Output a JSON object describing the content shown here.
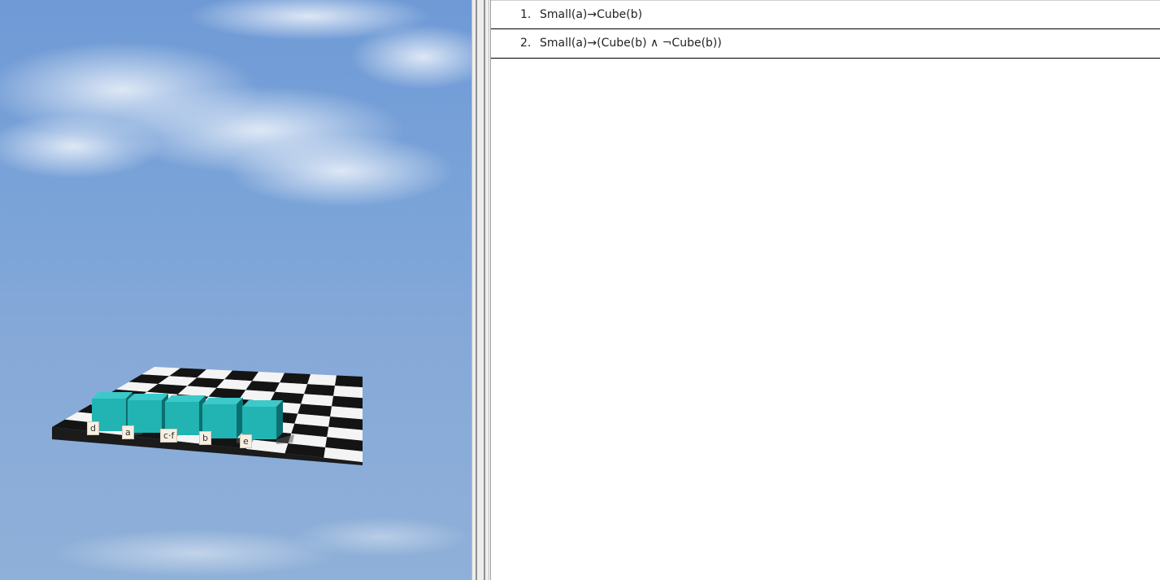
{
  "world": {
    "block_color": "#22b3b3",
    "sky_color": "#7aa3d8",
    "labels": {
      "d": "d",
      "a": "a",
      "cf": "c·f",
      "b": "b",
      "e": "e"
    }
  },
  "sentences": [
    {
      "number": "1.",
      "text": "Small(a)→Cube(b)"
    },
    {
      "number": "2.",
      "text": "Small(a)→(Cube(b) ∧ ¬Cube(b))"
    }
  ]
}
